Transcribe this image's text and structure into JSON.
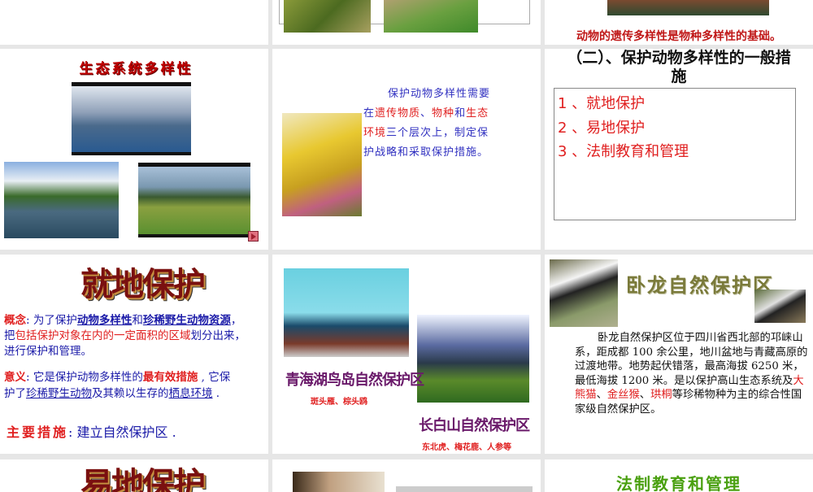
{
  "slides": {
    "s2": {
      "caption": "动物的遗传多样性是物种多样性的基础。"
    },
    "s3": {
      "title": "生态系统多样性"
    },
    "s4": {
      "l1": "保护动物多样性需要",
      "l2a": "在",
      "l2b": "遗传物质",
      "l2c": "、",
      "l2d": "物种",
      "l2e": "和",
      "l2f": "生态",
      "l3a": "环境",
      "l3b": "三个层次上，制定保",
      "l4": "护战略和采取保护措施。"
    },
    "s5": {
      "title_line1": "（二）、保护动物多样性的一般措",
      "title_line2": "施",
      "items": [
        "1 、就地保护",
        "2 、易地保护",
        "3 、法制教育和管理"
      ]
    },
    "s6": {
      "title": "就地保护",
      "concept_label": "概念",
      "concept": [
        ": 为了保护",
        "动物多样性",
        "和",
        "珍稀野生动物资源",
        "，",
        "把",
        "包括保护对象在内的一定面积的区域",
        "划分出来，",
        "进行保护和管理。"
      ],
      "meaning_label": "意义",
      "meaning": [
        ": 它是保护动物多样性的",
        "最有效措施",
        " , 它保",
        "护了",
        "珍稀野生动物",
        "及其赖以生存的",
        "栖息环境",
        " ."
      ],
      "measure_label": "主要措施",
      "measure": ": 建立自然保护区 ."
    },
    "s7": {
      "name1": "青海湖鸟岛自然保护区",
      "sub1": "斑头雁、棕头鸥",
      "name2": "长白山自然保护区",
      "sub2": "东北虎、梅花鹿、人参等"
    },
    "s8": {
      "title": "卧龙自然保护区",
      "p1": "卧龙自然保护区位于四川省西北部的邛崃山系，距成都 100 余公里，地川盆地与青藏高原的过渡地带。地势起伏错落，最高海拔 6250 米，最低海拔 1200 米。是以保护高山生态系统及",
      "r1": "大熊猫",
      "sep1": "、",
      "r2": "金丝猴",
      "sep2": "、",
      "r3": "珙桐",
      "p2": "等珍稀物种为主的综合性国家级自然保护区。"
    },
    "s9": {
      "title": "易地保护"
    },
    "s11": {
      "title": "法制教育和管理"
    }
  },
  "colors": {
    "gap": "#e6e6e6",
    "red": "#e02020",
    "blue": "#1a1aa8",
    "purple": "#6a1a6a"
  }
}
